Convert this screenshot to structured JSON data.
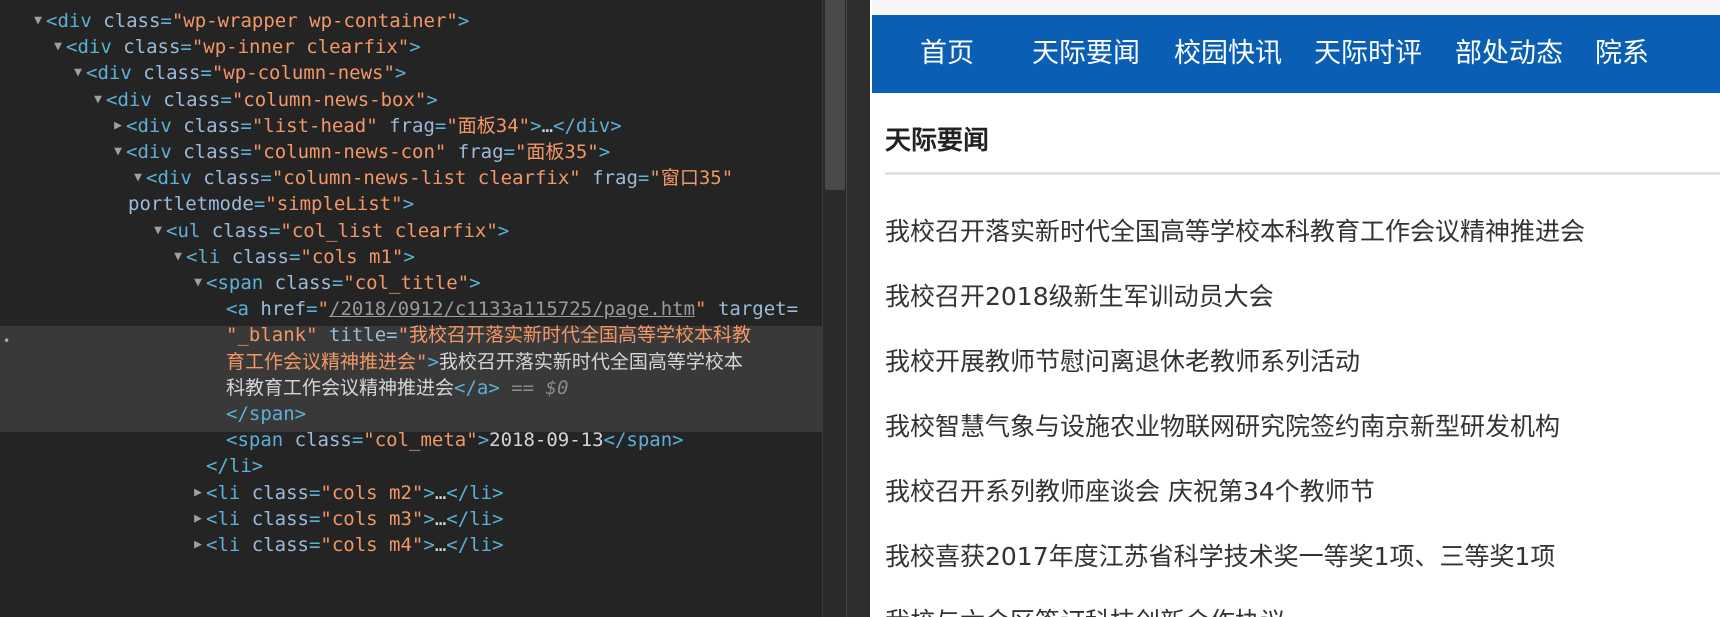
{
  "devtools": {
    "lines": [
      {
        "arrow": "▼",
        "tag": "div",
        "attrs": [
          {
            "n": "class",
            "v": "wp-wrapper wp-container"
          }
        ]
      },
      {
        "arrow": "▼",
        "tag": "div",
        "attrs": [
          {
            "n": "class",
            "v": "wp-inner clearfix"
          }
        ]
      },
      {
        "arrow": "▼",
        "tag": "div",
        "attrs": [
          {
            "n": "class",
            "v": "wp-column-news"
          }
        ]
      },
      {
        "arrow": "▼",
        "tag": "div",
        "attrs": [
          {
            "n": "class",
            "v": "column-news-box"
          }
        ]
      },
      {
        "arrow": "▶",
        "tag": "div",
        "attrs": [
          {
            "n": "class",
            "v": "list-head"
          },
          {
            "n": "frag",
            "v": "面板34"
          }
        ],
        "collapsed": "…</div>"
      },
      {
        "arrow": "▼",
        "tag": "div",
        "attrs": [
          {
            "n": "class",
            "v": "column-news-con"
          },
          {
            "n": "frag",
            "v": "面板35"
          }
        ]
      },
      {
        "arrow": "▼",
        "tag": "div",
        "attrs": [
          {
            "n": "class",
            "v": "column-news-list clearfix"
          },
          {
            "n": "frag",
            "v": "窗口35"
          }
        ]
      },
      {
        "continuation": "portletmode=\"simpleList\">"
      },
      {
        "arrow": "▼",
        "tag": "ul",
        "attrs": [
          {
            "n": "class",
            "v": "col_list clearfix"
          }
        ]
      },
      {
        "arrow": "▼",
        "tag": "li",
        "attrs": [
          {
            "n": "class",
            "v": "cols m1"
          }
        ]
      },
      {
        "arrow": "▼",
        "tag": "span",
        "attrs": [
          {
            "n": "class",
            "v": "col_title"
          }
        ]
      },
      {
        "selected_line_1": true
      },
      {
        "selected_line_2": true
      },
      {
        "selected_line_3": true
      },
      {
        "selected_line_4": true
      },
      {
        "close": "</span>"
      },
      {
        "meta": true
      },
      {
        "close": "</li>"
      },
      {
        "arrow": "▶",
        "tag": "li",
        "attrs": [
          {
            "n": "class",
            "v": "cols m2"
          }
        ],
        "collapsed": "…</li>"
      },
      {
        "arrow": "▶",
        "tag": "li",
        "attrs": [
          {
            "n": "class",
            "v": "cols m3"
          }
        ],
        "collapsed": "…</li>"
      },
      {
        "arrow": "▶",
        "tag": "li",
        "attrs": [
          {
            "n": "class",
            "v": "cols m4"
          }
        ],
        "collapsed": "…</li>"
      }
    ],
    "selected": {
      "href": "/2018/0912/c1133a115725/page.htm",
      "target_attr": "target=",
      "target_value": "\"_blank\"",
      "title_attr": "title=",
      "title_value_part1": "\"我校召开落实新时代全国高等学校本科教",
      "title_value_part2": "育工作会议精神推进会\"",
      "text_part1": "我校召开落实新时代全国高等学校本",
      "text_part2": "科教育工作会议精神推进会",
      "suffix": "== $0"
    },
    "meta": {
      "class_value": "col_meta",
      "text": "2018-09-13"
    }
  },
  "webpage": {
    "nav": [
      "首页",
      "天际要闻",
      "校园快讯",
      "天际时评",
      "部处动态",
      "院系"
    ],
    "section_title": "天际要闻",
    "news": [
      "我校召开落实新时代全国高等学校本科教育工作会议精神推进会",
      "我校召开2018级新生军训动员大会",
      "我校开展教师节慰问离退休老教师系列活动",
      "我校智慧气象与设施农业物联网研究院签约南京新型研发机构",
      "我校召开系列教师座谈会 庆祝第34个教师节",
      "我校喜获2017年度江苏省科学技术奖一等奖1项、三等奖1项",
      "我校与六合区签订科技创新合作协议"
    ]
  }
}
